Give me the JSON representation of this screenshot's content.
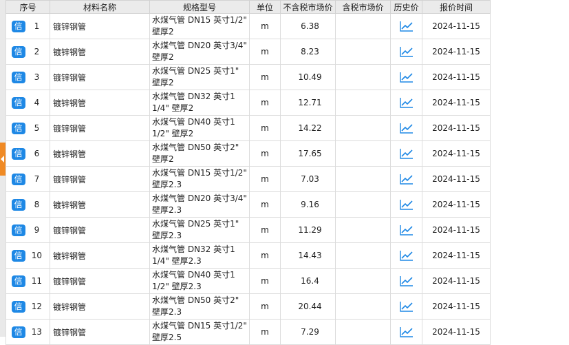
{
  "headers": {
    "seq": "序号",
    "name": "材料名称",
    "spec": "规格型号",
    "unit": "单位",
    "price_excl_tax": "不含税市场价",
    "price_incl_tax": "含税市场价",
    "history": "历史价",
    "quote_date": "报价时间"
  },
  "badge_label": "信",
  "colors": {
    "accent": "#1e88e5",
    "handle": "#f08a24",
    "header_bg": "#ebebeb"
  },
  "icons": {
    "history": "trend-line-icon",
    "collapse": "chevron-left-icon"
  },
  "rows": [
    {
      "seq": "1",
      "name": "镀锌钢管",
      "spec": "水煤气管 DN15 英寸1/2\" 壁厚2",
      "unit": "m",
      "price": "6.38",
      "tax_price": "",
      "date": "2024-11-15"
    },
    {
      "seq": "2",
      "name": "镀锌钢管",
      "spec": "水煤气管 DN20 英寸3/4\" 壁厚2",
      "unit": "m",
      "price": "8.23",
      "tax_price": "",
      "date": "2024-11-15"
    },
    {
      "seq": "3",
      "name": "镀锌钢管",
      "spec": "水煤气管 DN25 英寸1\" 壁厚2",
      "unit": "m",
      "price": "10.49",
      "tax_price": "",
      "date": "2024-11-15"
    },
    {
      "seq": "4",
      "name": "镀锌钢管",
      "spec": "水煤气管 DN32 英寸1 1/4\" 壁厚2",
      "unit": "m",
      "price": "12.71",
      "tax_price": "",
      "date": "2024-11-15"
    },
    {
      "seq": "5",
      "name": "镀锌钢管",
      "spec": "水煤气管 DN40 英寸1 1/2\" 壁厚2",
      "unit": "m",
      "price": "14.22",
      "tax_price": "",
      "date": "2024-11-15"
    },
    {
      "seq": "6",
      "name": "镀锌钢管",
      "spec": "水煤气管 DN50 英寸2\" 壁厚2",
      "unit": "m",
      "price": "17.65",
      "tax_price": "",
      "date": "2024-11-15"
    },
    {
      "seq": "7",
      "name": "镀锌钢管",
      "spec": "水煤气管 DN15 英寸1/2\" 壁厚2.3",
      "unit": "m",
      "price": "7.03",
      "tax_price": "",
      "date": "2024-11-15"
    },
    {
      "seq": "8",
      "name": "镀锌钢管",
      "spec": "水煤气管 DN20 英寸3/4\" 壁厚2.3",
      "unit": "m",
      "price": "9.16",
      "tax_price": "",
      "date": "2024-11-15"
    },
    {
      "seq": "9",
      "name": "镀锌钢管",
      "spec": "水煤气管 DN25 英寸1\" 壁厚2.3",
      "unit": "m",
      "price": "11.29",
      "tax_price": "",
      "date": "2024-11-15"
    },
    {
      "seq": "10",
      "name": "镀锌钢管",
      "spec": "水煤气管 DN32 英寸1 1/4\" 壁厚2.3",
      "unit": "m",
      "price": "14.43",
      "tax_price": "",
      "date": "2024-11-15"
    },
    {
      "seq": "11",
      "name": "镀锌钢管",
      "spec": "水煤气管 DN40 英寸1 1/2\" 壁厚2.3",
      "unit": "m",
      "price": "16.4",
      "tax_price": "",
      "date": "2024-11-15"
    },
    {
      "seq": "12",
      "name": "镀锌钢管",
      "spec": "水煤气管 DN50 英寸2\" 壁厚2.3",
      "unit": "m",
      "price": "20.44",
      "tax_price": "",
      "date": "2024-11-15"
    },
    {
      "seq": "13",
      "name": "镀锌钢管",
      "spec": "水煤气管 DN15 英寸1/2\" 壁厚2.5",
      "unit": "m",
      "price": "7.29",
      "tax_price": "",
      "date": "2024-11-15"
    }
  ]
}
